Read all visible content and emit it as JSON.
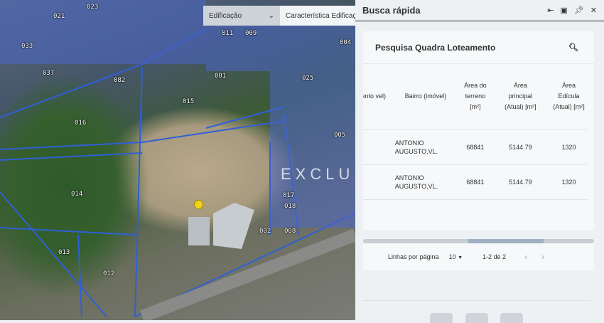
{
  "map": {
    "dropdown_edificacao": "Edificação",
    "dropdown_caracteristica": "Característica Edificação",
    "watermark": "EXCLUS",
    "parcel_labels": [
      "014",
      "016",
      "013",
      "012",
      "001",
      "017",
      "004",
      "025",
      "023",
      "011",
      "009",
      "021",
      "037",
      "082",
      "018",
      "008",
      "002",
      "015",
      "033",
      "005"
    ]
  },
  "panel": {
    "title": "Busca rápida",
    "header_icons": [
      "collapse-left-icon",
      "window-icon",
      "pin-icon",
      "close-icon"
    ],
    "search_title": "Pesquisa Quadra Loteamento",
    "columns": [
      {
        "label": "mento vel)"
      },
      {
        "label": "Bairro (imóvel)"
      },
      {
        "label": "Área do terreno [m²]"
      },
      {
        "label": "Área principal (Atual) [m²]"
      },
      {
        "label": "Área Edícula (Atual) [m²]"
      }
    ],
    "rows": [
      {
        "lot": "",
        "bairro": "ANTONIO AUGUSTO,VL.",
        "terreno": "68841",
        "principal": "5144.79",
        "edicula": "1320"
      },
      {
        "lot": "",
        "bairro": "ANTONIO AUGUSTO,VL.",
        "terreno": "68841",
        "principal": "5144.79",
        "edicula": "1320"
      }
    ],
    "scroll_position": 0.75,
    "pagination": {
      "rows_label": "Linhas por página",
      "rows_value": "10",
      "range": "1-2 de 2"
    }
  }
}
